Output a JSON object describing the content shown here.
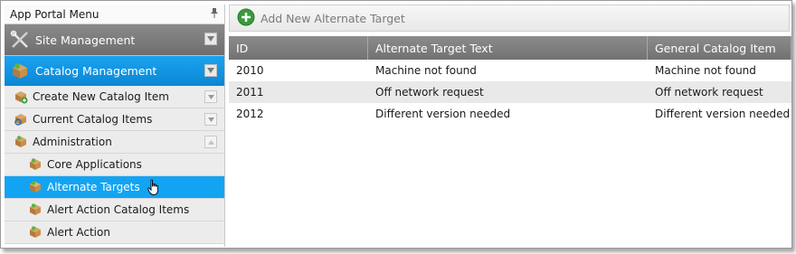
{
  "sidebar": {
    "title": "App Portal Menu",
    "pin_icon": "pin-icon",
    "site_section": {
      "label": "Site Management",
      "icon": "tools-icon"
    },
    "catalog_section": {
      "label": "Catalog Management",
      "icon": "package-icon"
    },
    "groups": [
      {
        "label": "Create New Catalog Item",
        "icon": "package-add-icon"
      },
      {
        "label": "Current Catalog Items",
        "icon": "package-search-icon"
      },
      {
        "label": "Administration",
        "icon": "package-icon"
      }
    ],
    "admin_items": [
      {
        "label": "Core Applications",
        "active": false
      },
      {
        "label": "Alternate Targets",
        "active": true
      },
      {
        "label": "Alert Action Catalog Items",
        "active": false
      },
      {
        "label": "Alert Action",
        "active": false
      }
    ]
  },
  "toolbar": {
    "add_label": "Add New Alternate Target",
    "add_icon": "plus-circle-icon"
  },
  "grid": {
    "columns": [
      "ID",
      "Alternate Target Text",
      "General Catalog Item"
    ],
    "rows": [
      [
        "2010",
        "Machine not found",
        "Machine not found"
      ],
      [
        "2011",
        "Off network request",
        "Off network request"
      ],
      [
        "2012",
        "Different version needed",
        "Different version needed"
      ]
    ]
  },
  "colors": {
    "accent": "#12a4f3",
    "header_gray": "#7e7e7e"
  }
}
